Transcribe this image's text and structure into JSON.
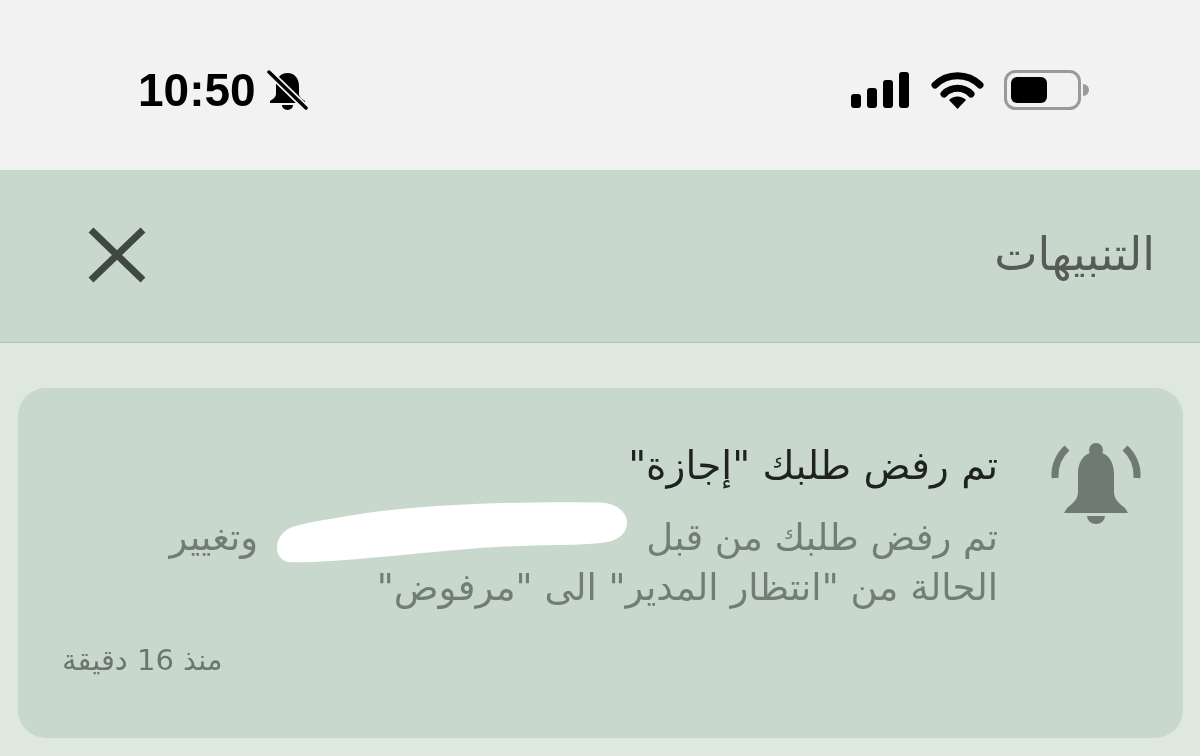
{
  "status_bar": {
    "time": "10:50"
  },
  "header": {
    "title": "التنبيهات"
  },
  "notifications": [
    {
      "title": "تم رفض طلبك \"إجازة\"",
      "body_lines": [
        [
          {
            "kind": "text",
            "text": "تم رفض طلبك من قبل"
          },
          {
            "kind": "redaction"
          },
          {
            "kind": "text",
            "text": "وتغيير"
          }
        ],
        [
          {
            "kind": "text",
            "text": "الحالة من \"انتظار المدير\" الى \"مرفوض\""
          }
        ]
      ],
      "time": "منذ 16 دقيقة"
    }
  ]
}
